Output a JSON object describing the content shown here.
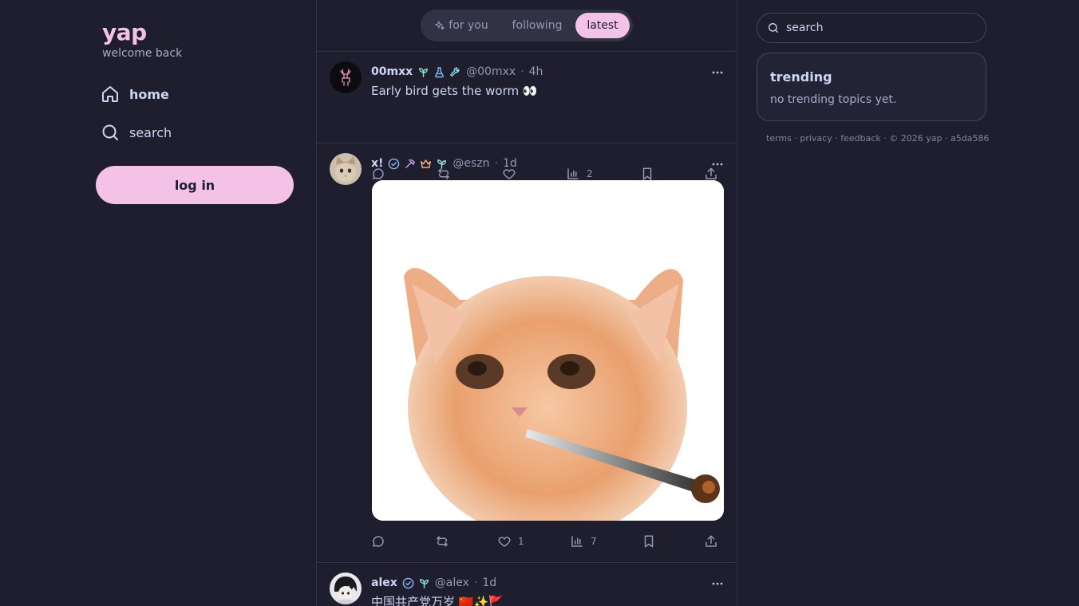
{
  "app": {
    "name": "yap",
    "tagline": "welcome back"
  },
  "nav": {
    "items": [
      {
        "label": "home",
        "icon": "home-icon",
        "active": true
      },
      {
        "label": "search",
        "icon": "search-icon",
        "active": false
      }
    ],
    "login_label": "log in"
  },
  "feed": {
    "tabs": [
      {
        "label": "for you",
        "icon": "sparkles-icon",
        "active": false
      },
      {
        "label": "following",
        "active": false
      },
      {
        "label": "latest",
        "active": true
      }
    ],
    "posts": [
      {
        "author": "00mxx",
        "badges": [
          "sprout-icon",
          "flask-icon",
          "wrench-icon"
        ],
        "handle": "@00mxx",
        "time": "4h",
        "text": "Early bird gets the worm 👀",
        "replies": "",
        "reposts": "",
        "likes": "",
        "views": "2"
      },
      {
        "author": "x!",
        "badges": [
          "verified-icon",
          "hammer-icon",
          "crown-icon",
          "sprout-icon"
        ],
        "handle": "@eszn",
        "time": "1d",
        "text": "",
        "image": "kitten-with-cigarette",
        "replies": "",
        "reposts": "",
        "likes": "1",
        "views": "7"
      },
      {
        "author": "alex",
        "badges": [
          "verified-icon",
          "sprout-icon"
        ],
        "handle": "@alex",
        "time": "1d",
        "text": "中国共产党万岁 🇨🇳✨🚩"
      }
    ]
  },
  "sidebar_right": {
    "search_placeholder": "search",
    "trending_title": "trending",
    "trending_empty": "no trending topics yet.",
    "footer": {
      "terms": "terms",
      "privacy": "privacy",
      "feedback": "feedback",
      "copyright": "© 2026 yap",
      "version": "a5da586"
    }
  },
  "colors": {
    "background": "#1e1e2e",
    "accent": "#f5c2e7",
    "border": "#313244",
    "muted_text": "#9399b2"
  }
}
